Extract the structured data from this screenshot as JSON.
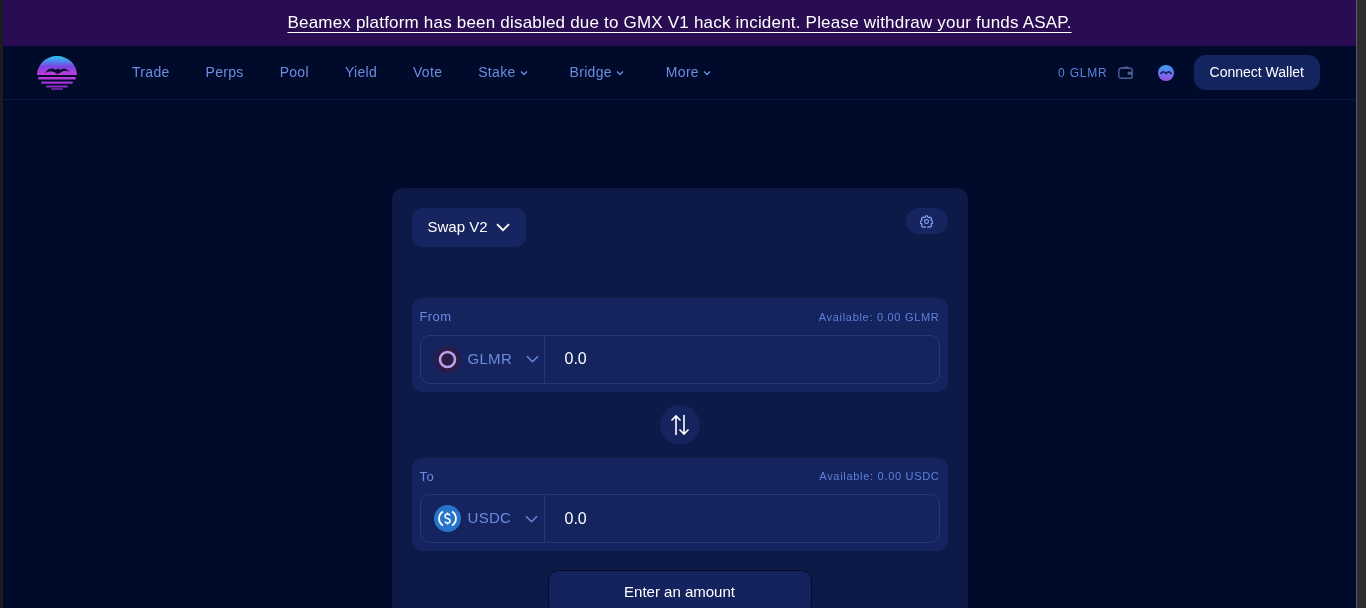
{
  "banner": {
    "text": "Beamex platform has been disabled due to GMX V1 hack incident. Please withdraw your funds ASAP."
  },
  "nav": {
    "items": [
      {
        "label": "Trade",
        "dropdown": false
      },
      {
        "label": "Perps",
        "dropdown": false
      },
      {
        "label": "Pool",
        "dropdown": false
      },
      {
        "label": "Yield",
        "dropdown": false
      },
      {
        "label": "Vote",
        "dropdown": false
      },
      {
        "label": "Stake",
        "dropdown": true
      },
      {
        "label": "Bridge",
        "dropdown": true
      },
      {
        "label": "More",
        "dropdown": true
      }
    ],
    "balance": "0 GLMR",
    "connect_button": "Connect Wallet"
  },
  "swap": {
    "mode_button": "Swap V2",
    "fields": [
      {
        "label": "From",
        "available": "Available: 0.00 GLMR",
        "token": {
          "symbol": "GLMR",
          "kind": "ring"
        },
        "amount": {
          "placeholder": "0.0"
        }
      },
      {
        "label": "To",
        "available": "Available: 0.00 USDC",
        "token": {
          "symbol": "USDC",
          "kind": "coin"
        },
        "amount": {
          "placeholder": "0.0"
        }
      }
    ],
    "submit_button": "Enter an amount"
  }
}
